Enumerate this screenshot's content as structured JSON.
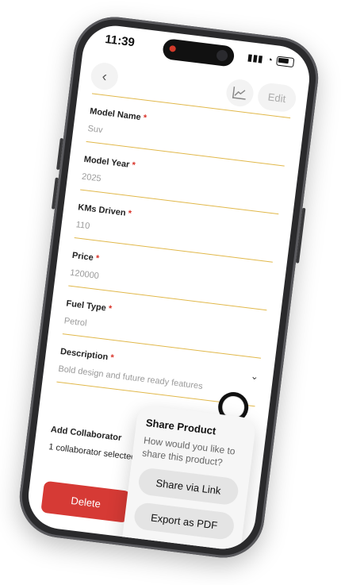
{
  "status_bar": {
    "time": "11:39"
  },
  "header": {
    "edit_label": "Edit"
  },
  "form": {
    "fields": [
      {
        "label": "Model Name",
        "value": "Suv"
      },
      {
        "label": "Model Year",
        "value": "2025"
      },
      {
        "label": "KMs Driven",
        "value": "110"
      },
      {
        "label": "Price",
        "value": "120000"
      },
      {
        "label": "Fuel Type",
        "value": "Petrol"
      },
      {
        "label": "Description",
        "value": "Bold design and future ready features"
      }
    ],
    "required_mark": "*",
    "add_collaborator_label": "Add Collaborator",
    "collaborator_count_text": "1 collaborator selected"
  },
  "actions": {
    "delete_label": "Delete"
  },
  "share_sheet": {
    "title": "Share Product",
    "subtitle": "How would you like to share this product?",
    "option_link": "Share via Link",
    "option_pdf": "Export as PDF"
  },
  "colors": {
    "accent_line": "#e1b84a",
    "required": "#d9352b",
    "delete_button": "#d63a35",
    "save_button": "#1c2431"
  }
}
